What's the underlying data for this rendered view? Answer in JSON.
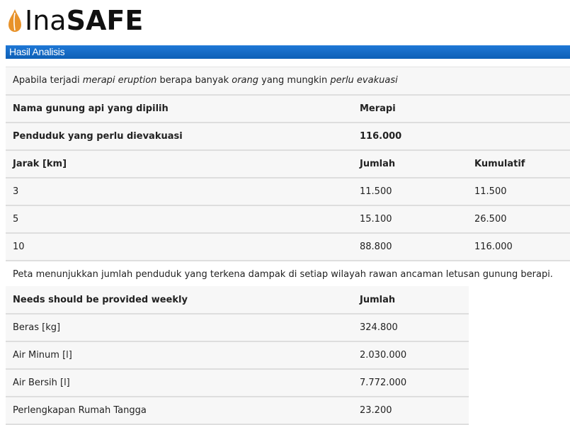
{
  "logo": {
    "text_regular": "Ina",
    "text_bold": "SAFE",
    "icon": "leaf-drop-icon",
    "icon_color": "#e8922a"
  },
  "header": {
    "title": "Hasil Analisis",
    "color": "#1469c6"
  },
  "intro": {
    "part1": "Apabila terjadi ",
    "hazard": "merapi eruption",
    "part2": " berapa banyak ",
    "exposure": "orang",
    "part3": " yang mungkin ",
    "impact": "perlu evakuasi"
  },
  "volcano": {
    "label": "Nama gunung api yang dipilih",
    "value": "Merapi"
  },
  "evacuated": {
    "label": "Penduduk yang perlu dievakuasi",
    "value": "116.000"
  },
  "distance_table": {
    "headers": [
      "Jarak [km]",
      "Jumlah",
      "Kumulatif"
    ],
    "rows": [
      [
        "3",
        "11.500",
        "11.500"
      ],
      [
        "5",
        "15.100",
        "26.500"
      ],
      [
        "10",
        "88.800",
        "116.000"
      ]
    ]
  },
  "map_note": "Peta menunjukkan jumlah penduduk yang terkena dampak di setiap wilayah rawan ancaman letusan gunung berapi.",
  "needs_table": {
    "headers": [
      "Needs should be provided weekly",
      "Jumlah"
    ],
    "rows": [
      [
        "Beras [kg]",
        "324.800"
      ],
      [
        "Air Minum [l]",
        "2.030.000"
      ],
      [
        "Air Bersih [l]",
        "7.772.000"
      ],
      [
        "Perlengkapan Rumah Tangga",
        "23.200"
      ]
    ]
  }
}
